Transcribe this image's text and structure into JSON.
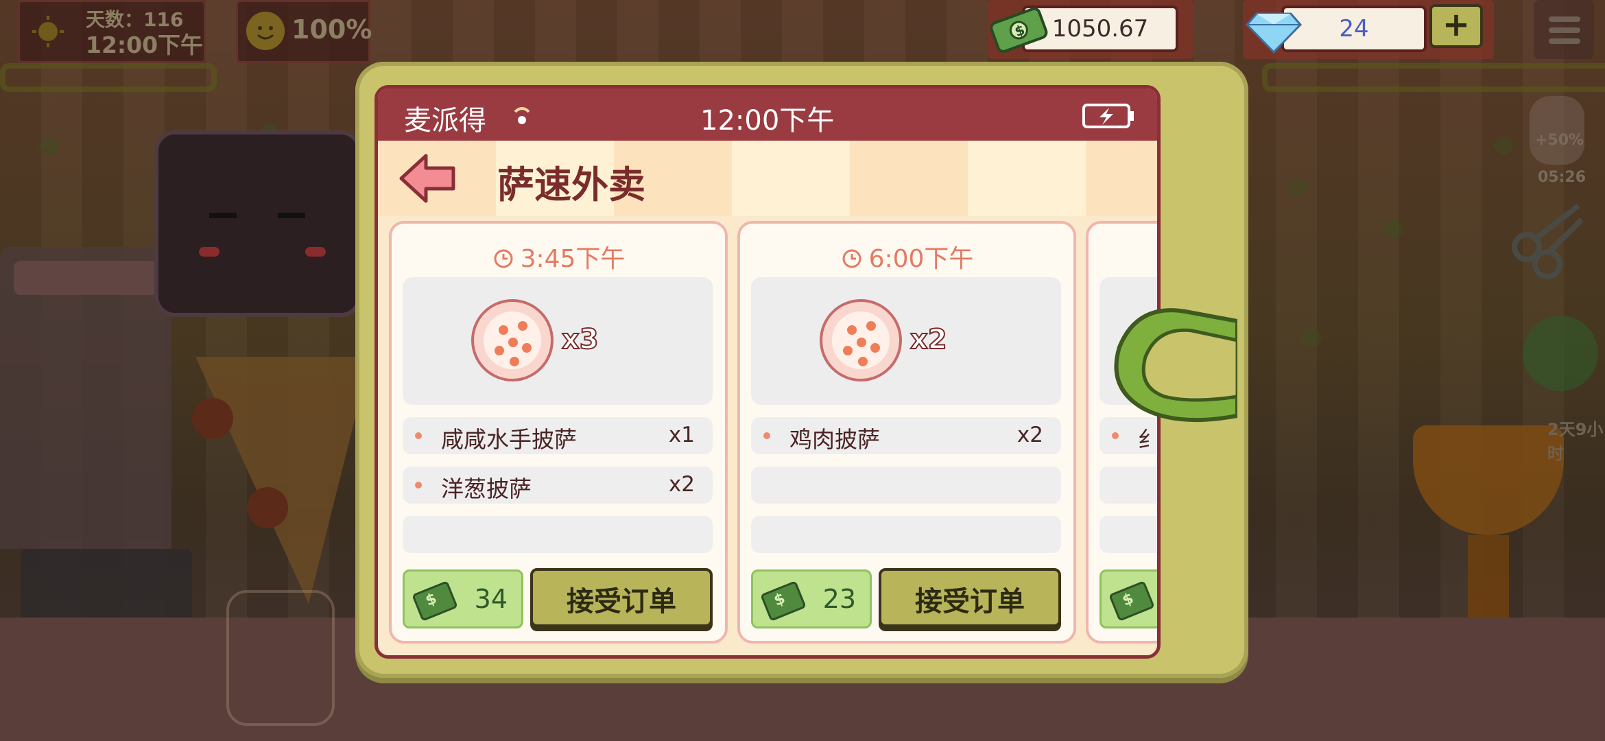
{
  "hud": {
    "day_label": "天数：116",
    "clock": "12:00下午",
    "mood_percent": "100%",
    "money": "1050.67",
    "gems": "24",
    "add_label": "+",
    "side_bonus": "+50%",
    "side_timer": "05:26",
    "side_duration": "2天9小时"
  },
  "phone": {
    "carrier": "麦派得",
    "time": "12:00下午",
    "app_title": "萨速外卖"
  },
  "orders": [
    {
      "due_time": "3:45下午",
      "pizza_qty": "x3",
      "items": [
        {
          "name": "咸咸水手披萨",
          "count": "x1"
        },
        {
          "name": "洋葱披萨",
          "count": "x2"
        }
      ],
      "reward": "34",
      "accept_label": "接受订单"
    },
    {
      "due_time": "6:00下午",
      "pizza_qty": "x2",
      "items": [
        {
          "name": "鸡肉披萨",
          "count": "x2"
        }
      ],
      "reward": "23",
      "accept_label": "接受订单"
    },
    {
      "items": [
        {
          "name": "纟"
        }
      ]
    }
  ],
  "colors": {
    "status_bar": "#9a3b42",
    "phone_frame": "#c9c46b",
    "accent_text": "#e47a62",
    "accept_button": "#b7b45a",
    "reward_bg": "#bfe28f"
  },
  "icons": [
    "sun-icon",
    "smiley-icon",
    "cash-icon",
    "diamond-icon",
    "plus-icon",
    "menu-icon",
    "signal-icon",
    "battery-icon",
    "back-arrow-icon",
    "clock-icon",
    "pizza-icon",
    "swipe-hand-icon"
  ]
}
